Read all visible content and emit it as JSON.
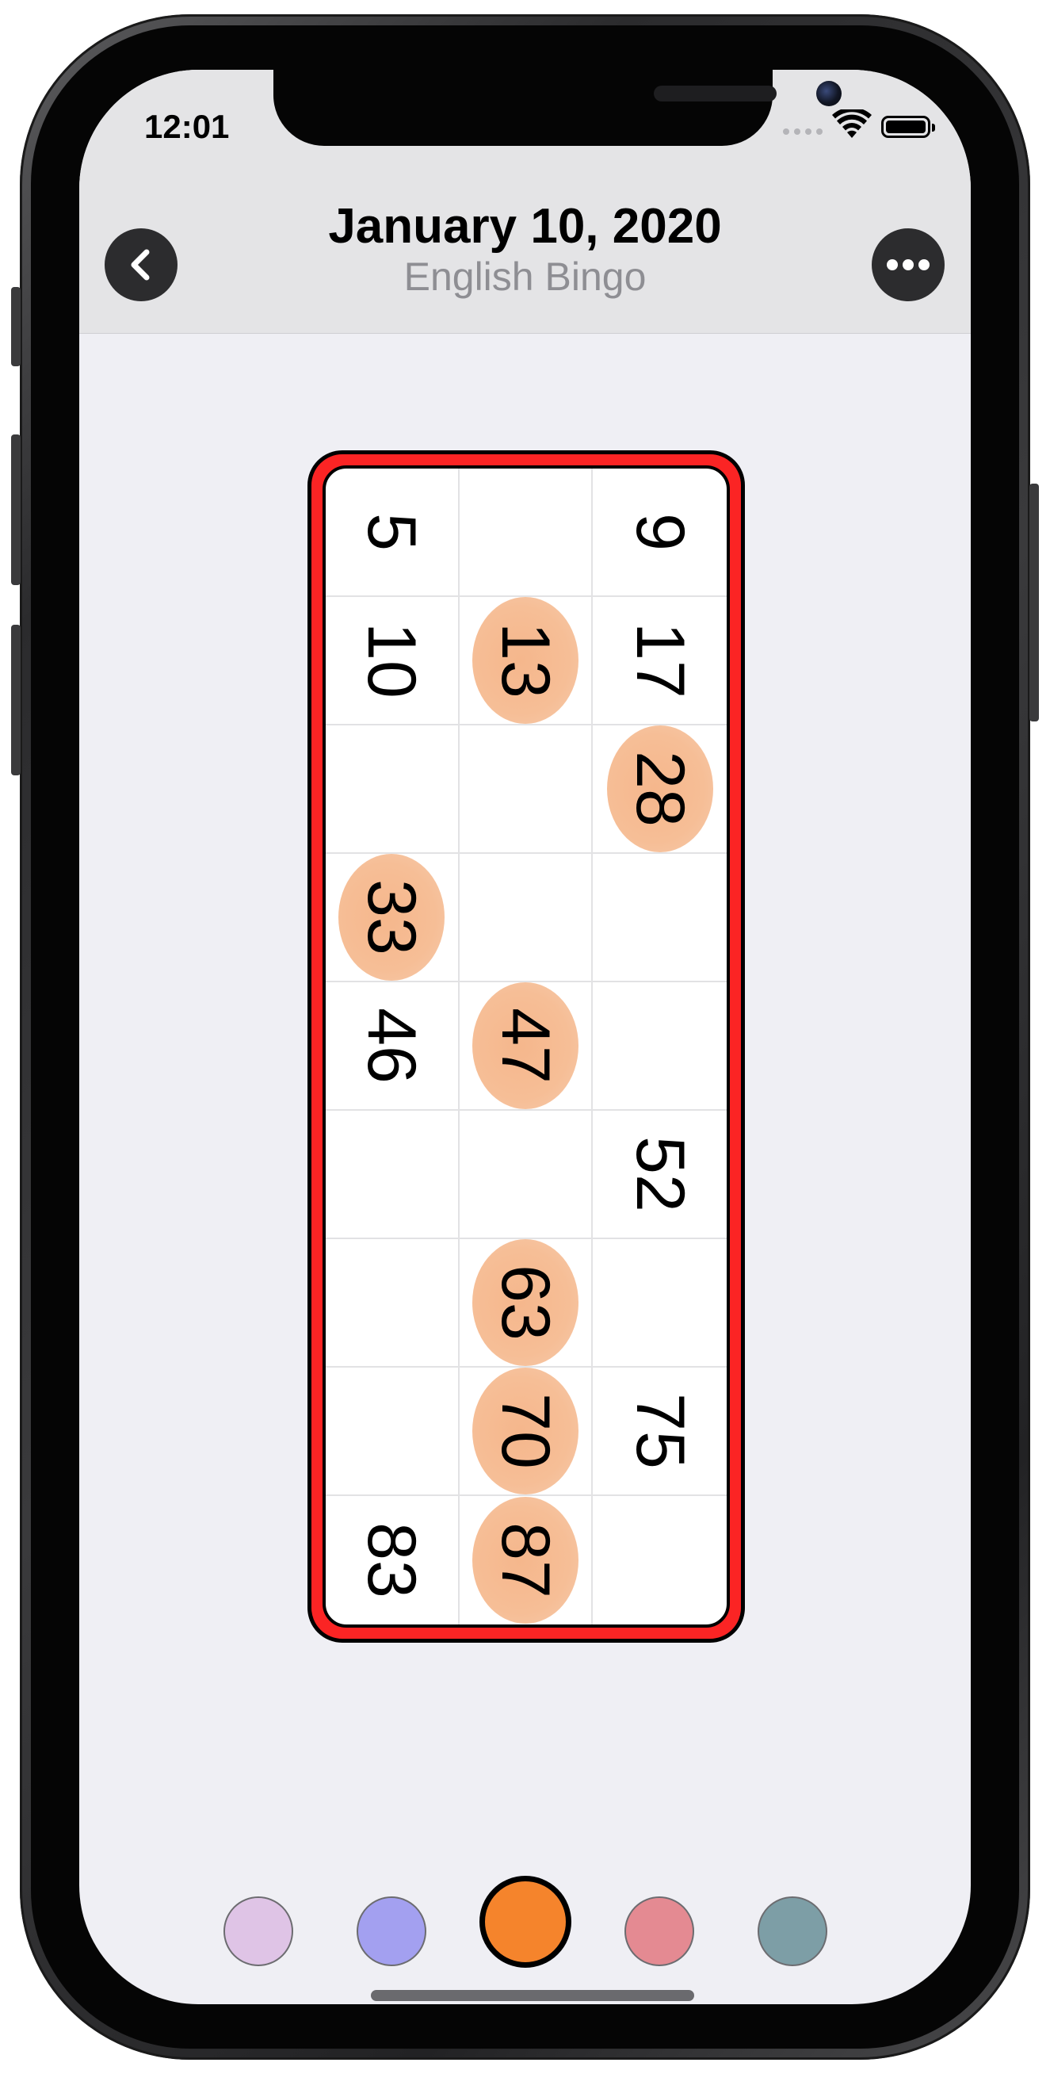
{
  "status_bar": {
    "time": "12:01"
  },
  "header": {
    "title": "January 10, 2020",
    "subtitle": "English Bingo"
  },
  "card": {
    "frame_color": "#fb2424",
    "marker_color": "#f3a06a",
    "rows": [
      [
        {
          "n": "5",
          "m": false
        },
        {
          "n": "",
          "m": false
        },
        {
          "n": "9",
          "m": false
        }
      ],
      [
        {
          "n": "10",
          "m": false
        },
        {
          "n": "13",
          "m": true
        },
        {
          "n": "17",
          "m": false
        }
      ],
      [
        {
          "n": "",
          "m": false
        },
        {
          "n": "",
          "m": false
        },
        {
          "n": "28",
          "m": true
        }
      ],
      [
        {
          "n": "33",
          "m": true
        },
        {
          "n": "",
          "m": false
        },
        {
          "n": "",
          "m": false
        }
      ],
      [
        {
          "n": "46",
          "m": false
        },
        {
          "n": "47",
          "m": true
        },
        {
          "n": "",
          "m": false
        }
      ],
      [
        {
          "n": "",
          "m": false
        },
        {
          "n": "",
          "m": false
        },
        {
          "n": "52",
          "m": false
        }
      ],
      [
        {
          "n": "",
          "m": false
        },
        {
          "n": "63",
          "m": true
        },
        {
          "n": "",
          "m": false
        }
      ],
      [
        {
          "n": "",
          "m": false
        },
        {
          "n": "70",
          "m": true
        },
        {
          "n": "75",
          "m": false
        }
      ],
      [
        {
          "n": "83",
          "m": false
        },
        {
          "n": "87",
          "m": true
        },
        {
          "n": "",
          "m": false
        }
      ]
    ]
  },
  "color_picker": {
    "colors": [
      "#dfc4e6",
      "#a3a0f0",
      "#f5842c",
      "#e48a92",
      "#7d9ea6"
    ],
    "selected_index": 2
  }
}
